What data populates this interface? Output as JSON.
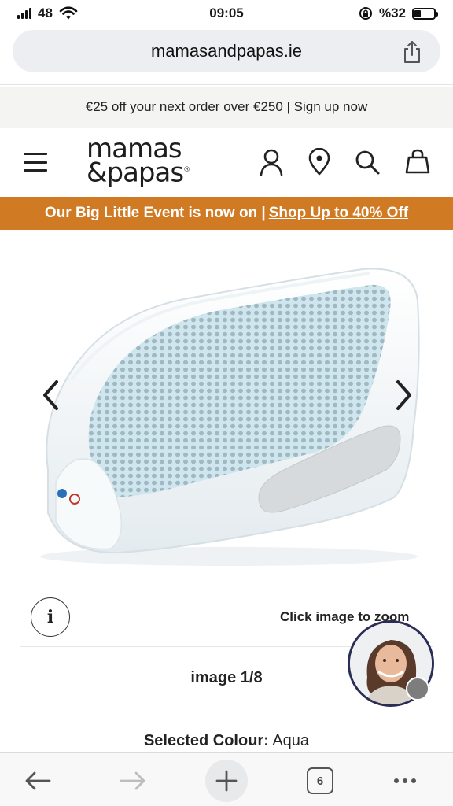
{
  "status_bar": {
    "signal_label": "48",
    "time": "09:05",
    "battery_label": "%32",
    "battery_level": 0.32,
    "icons": [
      "signal-icon",
      "wifi-icon",
      "rotation-lock-icon",
      "battery-icon"
    ]
  },
  "browser": {
    "url": "mamasandpapas.ie",
    "share_icon": "share-icon",
    "toolbar": {
      "back_icon": "back-arrow-icon",
      "forward_icon": "forward-arrow-icon",
      "new_tab_icon": "plus-icon",
      "tab_count": "6",
      "more_icon": "more-dots-icon"
    }
  },
  "promo": {
    "text": "€25 off your next order over €250 | Sign up now"
  },
  "header": {
    "logo_line1": "mamas",
    "logo_line2": "&papas",
    "logo_mark": "®",
    "icons": [
      "menu-icon",
      "account-icon",
      "store-locator-icon",
      "search-icon",
      "bag-icon"
    ]
  },
  "event_banner": {
    "text": "Our Big Little Event is now on |",
    "link_text": "Shop Up to 40% Off",
    "background": "#d17a24"
  },
  "gallery": {
    "product_image": "aqua-baby-bath-support-image",
    "prev_icon": "chevron-left-icon",
    "next_icon": "chevron-right-icon",
    "info_label": "i",
    "zoom_hint": "Click image to zoom",
    "counter": "image 1/8"
  },
  "product": {
    "selected_colour_label": "Selected Colour:",
    "selected_colour_value": "Aqua"
  },
  "chat": {
    "avatar": "chat-agent-avatar",
    "border_color": "#2a2d55"
  }
}
